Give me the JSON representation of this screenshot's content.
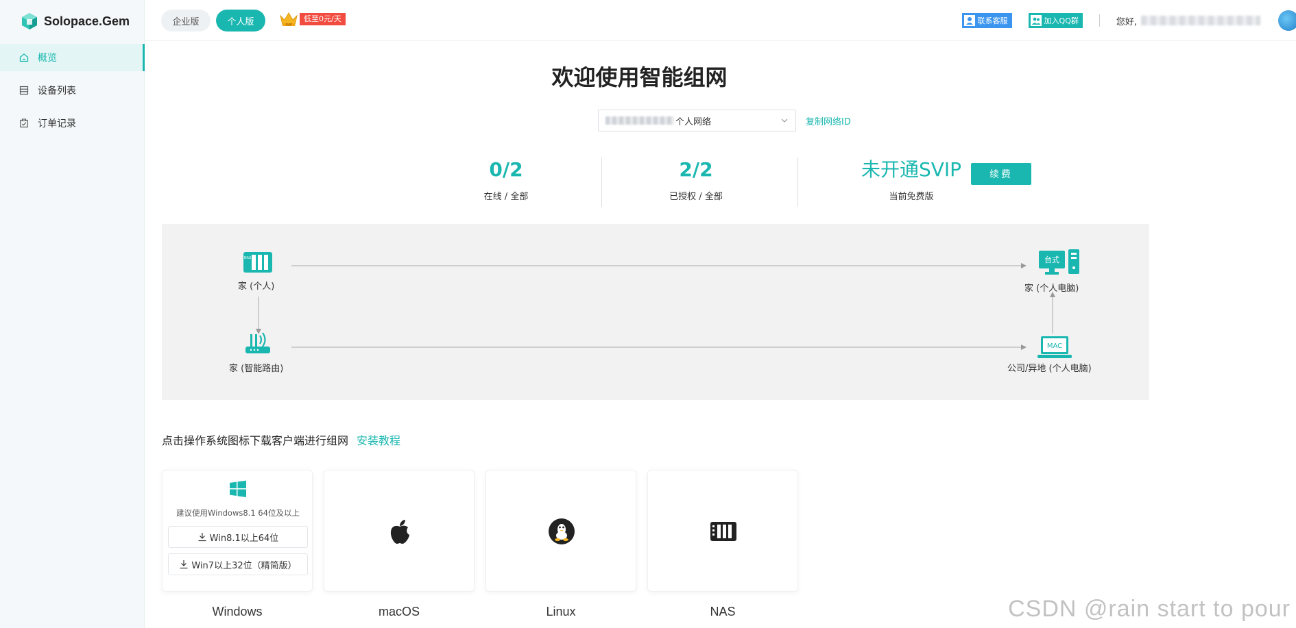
{
  "brand": {
    "name": "Solopace.Gem",
    "accent": "#1ab7b0"
  },
  "sidebar": {
    "items": [
      {
        "label": "概览",
        "icon": "home-icon",
        "active": true
      },
      {
        "label": "设备列表",
        "icon": "list-icon",
        "active": false
      },
      {
        "label": "订单记录",
        "icon": "clipboard-icon",
        "active": false
      }
    ]
  },
  "header": {
    "tabs": [
      {
        "label": "企业版",
        "active": false
      },
      {
        "label": "个人版",
        "active": true
      }
    ],
    "promo": {
      "crown_label": "SVIP",
      "tag": "低至0元/天"
    },
    "support_label": "联系客服",
    "qq_label": "加入QQ群",
    "greeting": "您好,"
  },
  "main": {
    "title": "欢迎使用智能组网",
    "network_select": {
      "suffix": "个人网络"
    },
    "copy_label": "复制网络ID",
    "stats": [
      {
        "value": "0/2",
        "label": "在线 / 全部"
      },
      {
        "value": "2/2",
        "label": "已授权 / 全部"
      },
      {
        "value": "未开通SVIP",
        "label": "当前免费版"
      }
    ],
    "renew_label": "续费",
    "diagram": {
      "nas_label": "家 (个人)",
      "nas_icon_text": "NAS",
      "router_label": "家 (智能路由)",
      "desktop_label": "家 (个人电脑)",
      "desktop_icon_text": "台式",
      "mac_label": "公司/异地 (个人电脑)",
      "mac_icon_text": "MAC"
    },
    "download": {
      "prompt": "点击操作系统图标下载客户端进行组网",
      "tutorial": "安装教程"
    },
    "os_cards": [
      {
        "name": "Windows",
        "icon": "windows-icon"
      },
      {
        "name": "macOS",
        "icon": "apple-icon"
      },
      {
        "name": "Linux",
        "icon": "linux-icon"
      },
      {
        "name": "NAS",
        "icon": "nas-icon"
      }
    ],
    "windows": {
      "note": "建议使用Windows8.1 64位及以上",
      "btn64": "Win8.1以上64位",
      "btn32": "Win7以上32位（精简版）"
    }
  },
  "watermark": "CSDN @rain start to pour"
}
